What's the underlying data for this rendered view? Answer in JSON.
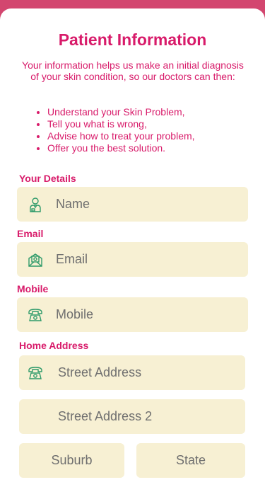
{
  "header": {
    "title": "Patient Information",
    "intro": "Your information helps us make an initial diagnosis of your skin condition, so our doctors can then:",
    "bullets": [
      "Understand your Skin Problem,",
      "Tell you what is wrong,",
      "Advise how to treat your problem,",
      "Offer you the best solution."
    ]
  },
  "sections": {
    "your_details": "Your Details",
    "email": "Email",
    "mobile": "Mobile",
    "home_address": "Home Address"
  },
  "fields": {
    "name": {
      "placeholder": "Name",
      "icon": "doctor-icon"
    },
    "email": {
      "placeholder": "Email",
      "icon": "envelope-icon"
    },
    "mobile": {
      "placeholder": "Mobile",
      "icon": "telephone-icon"
    },
    "street1": {
      "placeholder": "Street Address",
      "icon": "telephone-icon"
    },
    "street2": {
      "placeholder": "Street Address 2"
    },
    "suburb": {
      "placeholder": "Suburb"
    },
    "state": {
      "placeholder": "State"
    }
  },
  "colors": {
    "accent": "#d81b6a",
    "topbar": "#d3466f",
    "field_bg": "#f7f0d3",
    "icon": "#2e9a6a"
  }
}
